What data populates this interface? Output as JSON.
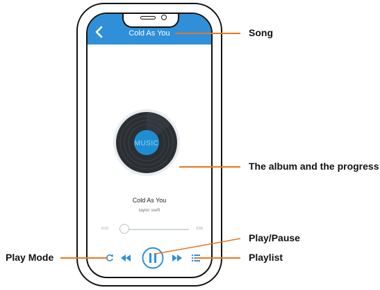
{
  "header": {
    "title": "Cold As You",
    "back_icon": "chevron-left-icon"
  },
  "now_playing": {
    "song_title": "Cold As You",
    "artist": "taylor swift",
    "album_art_text": "MUSIC"
  },
  "progress": {
    "elapsed": "0:10",
    "duration": "3:59",
    "fraction": 0.07
  },
  "controls": {
    "play_mode_icon": "repeat-icon",
    "previous_icon": "rewind-icon",
    "play_pause_icon": "pause-icon",
    "next_icon": "fast-forward-icon",
    "playlist_icon": "list-icon"
  },
  "callouts": {
    "song": "Song",
    "album": "The album and the progress",
    "play_pause": "Play/Pause",
    "playlist": "Playlist",
    "play_mode": "Play Mode"
  },
  "colors": {
    "accent": "#2f8fd8",
    "callout_line": "#e8761f",
    "record": "#2b2f33",
    "record_center": "#1f8ed1"
  }
}
